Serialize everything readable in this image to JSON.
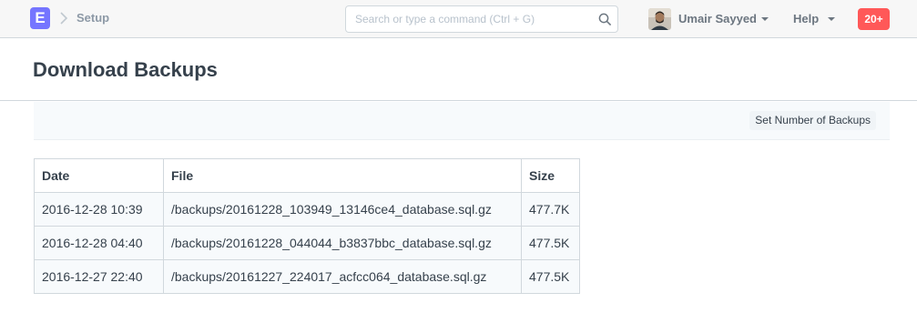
{
  "navbar": {
    "logo_letter": "E",
    "breadcrumb": "Setup",
    "search_placeholder": "Search or type a command (Ctrl + G)",
    "user_name": "Umair Sayyed",
    "help_label": "Help",
    "notification_count": "20+",
    "colors": {
      "logo": "#7575ff",
      "notification": "#ff5858"
    }
  },
  "page": {
    "title": "Download Backups",
    "set_backups_label": "Set Number of Backups"
  },
  "table": {
    "headers": [
      "Date",
      "File",
      "Size"
    ],
    "rows": [
      [
        "2016-12-28 10:39",
        "/backups/20161228_103949_13146ce4_database.sql.gz",
        "477.7K"
      ],
      [
        "2016-12-28 04:40",
        "/backups/20161228_044044_b3837bbc_database.sql.gz",
        "477.5K"
      ],
      [
        "2016-12-27 22:40",
        "/backups/20161227_224017_acfcc064_database.sql.gz",
        "477.5K"
      ]
    ]
  }
}
